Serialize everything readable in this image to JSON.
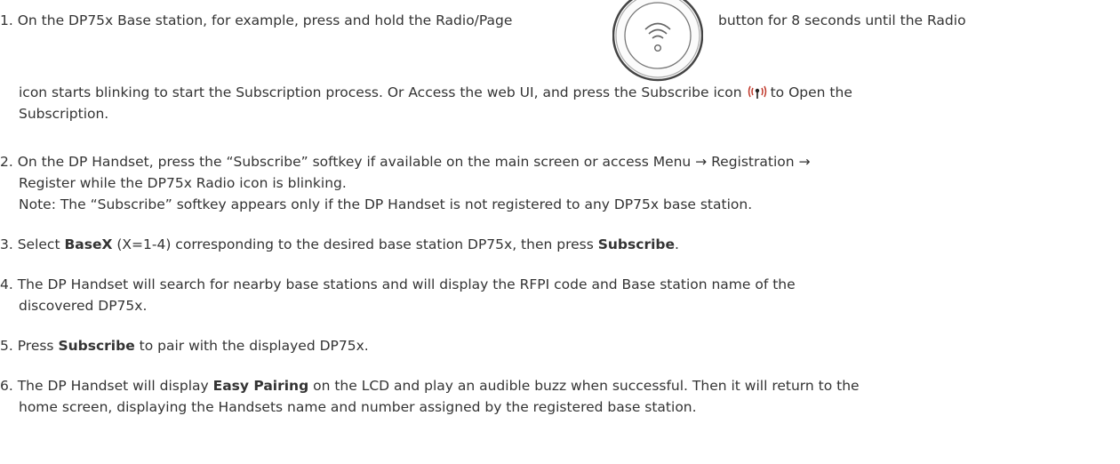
{
  "step1": {
    "a": "1. On the DP75x Base station, for example, press and hold the Radio/Page",
    "b": "button for 8 seconds until the Radio",
    "c": "icon starts blinking to start the Subscription process. Or Access the web UI, and press the Subscribe icon",
    "d": "to Open the",
    "e": "Subscription.",
    "radio_button_icon": "radio-page-button-icon",
    "subscribe_icon": "subscribe-antenna-icon"
  },
  "step2": {
    "a": "2. On the DP Handset, press the “Subscribe” softkey if available on the main screen or access Menu → Registration →",
    "b": "Register while the DP75x Radio icon is blinking.",
    "note": "Note: The “Subscribe” softkey appears only if the DP Handset is not registered to any DP75x base station."
  },
  "step3": {
    "a": "3. Select ",
    "bold1": "BaseX",
    "b": " (X=1-4) corresponding to the desired base station DP75x, then press ",
    "bold2": "Subscribe",
    "c": "."
  },
  "step4": {
    "a": "4. The DP Handset will search for nearby base stations and will display the RFPI code and Base station name of the",
    "b": "discovered DP75x."
  },
  "step5": {
    "a": "5. Press ",
    "bold": "Subscribe",
    "b": " to pair with the displayed DP75x."
  },
  "step6": {
    "a": "6. The DP Handset will display ",
    "bold": "Easy Pairing",
    "b": " on the LCD and play an audible buzz when successful. Then it will return to the",
    "c": "home screen, displaying the Handsets name and number assigned by the registered base station."
  }
}
